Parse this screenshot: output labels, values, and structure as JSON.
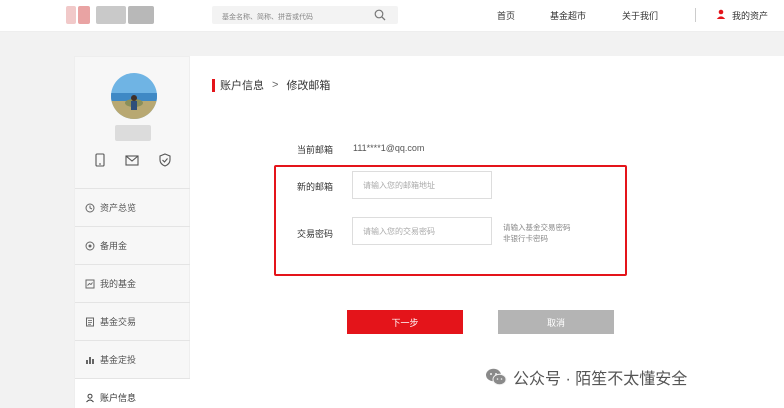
{
  "header": {
    "search_placeholder": "基金名称、简称、拼音或代码",
    "nav": [
      "首页",
      "基金超市",
      "关于我们"
    ],
    "my_assets": "我的资产"
  },
  "sidebar": {
    "items": [
      {
        "label": "资产总览",
        "icon": "clock-icon"
      },
      {
        "label": "备用金",
        "icon": "coin-icon"
      },
      {
        "label": "我的基金",
        "icon": "chart-box-icon"
      },
      {
        "label": "基金交易",
        "icon": "document-icon"
      },
      {
        "label": "基金定投",
        "icon": "bar-chart-icon"
      },
      {
        "label": "账户信息",
        "icon": "user-icon"
      }
    ]
  },
  "breadcrumb": {
    "parent": "账户信息",
    "separator": ">",
    "current": "修改邮箱"
  },
  "form": {
    "current_email_label": "当前邮箱",
    "current_email_value": "111****1@qq.com",
    "new_email_label": "新的邮箱",
    "new_email_placeholder": "请输入您的邮箱地址",
    "trade_password_label": "交易密码",
    "trade_password_placeholder": "请输入您的交易密码",
    "hint_line1": "请输入基金交易密码",
    "hint_line2": "非银行卡密码",
    "next_button": "下一步",
    "cancel_button": "取消"
  },
  "watermark": "公众号 · 陌笙不太懂安全",
  "colors": {
    "accent": "#e4141a",
    "cancel": "#b4b4b4"
  }
}
